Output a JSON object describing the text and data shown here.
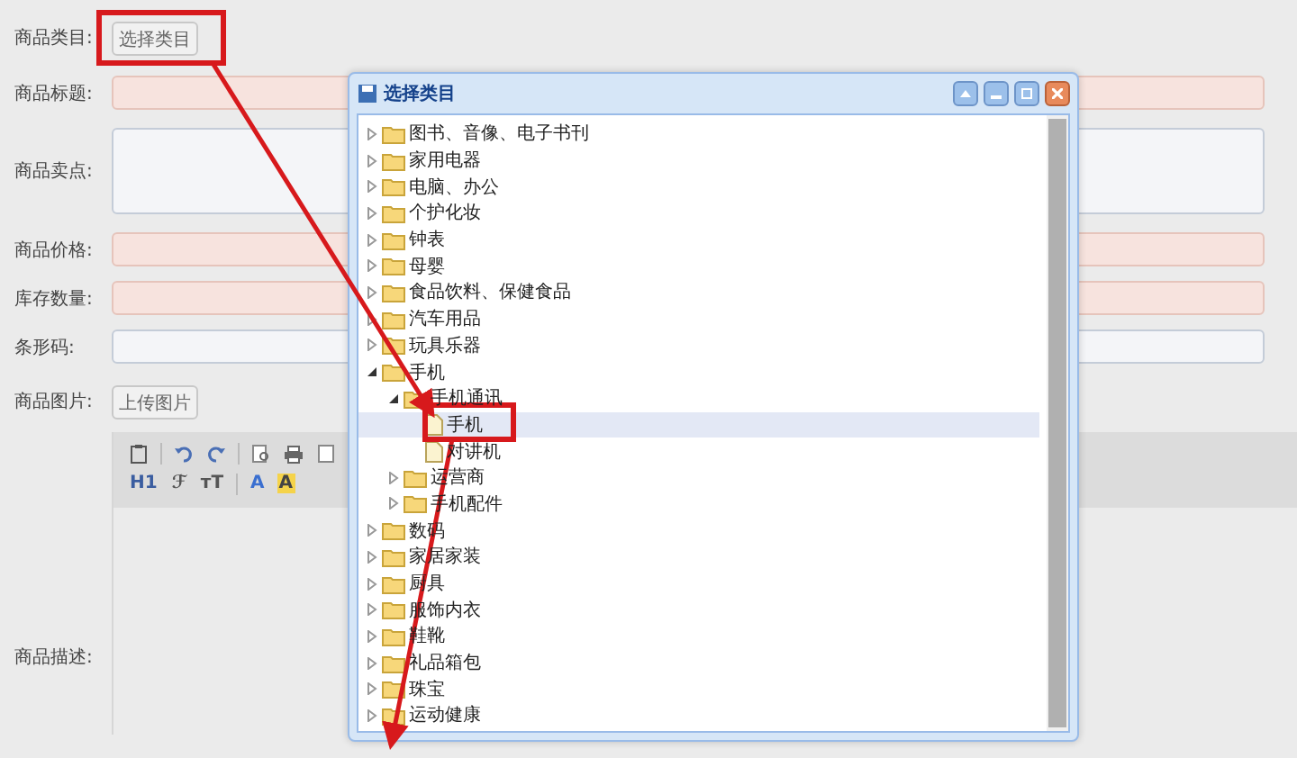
{
  "form": {
    "fields": [
      {
        "label": "商品类目:",
        "kind": "button",
        "button_label": "选择类目"
      },
      {
        "label": "商品标题:",
        "kind": "input",
        "required": true
      },
      {
        "label": "商品卖点:",
        "kind": "textarea",
        "required": false
      },
      {
        "label": "商品价格:",
        "kind": "input",
        "required": true
      },
      {
        "label": "库存数量:",
        "kind": "input",
        "required": true
      },
      {
        "label": "条形码:",
        "kind": "input",
        "required": false
      },
      {
        "label": "商品图片:",
        "kind": "button",
        "button_label": "上传图片"
      }
    ],
    "editor": {
      "label": "商品描述:",
      "toolbar_rows": [
        [
          {
            "kind": "paste"
          },
          {
            "kind": "separator"
          },
          {
            "kind": "undo"
          },
          {
            "kind": "redo"
          },
          {
            "kind": "separator"
          },
          {
            "kind": "preview"
          },
          {
            "kind": "print"
          },
          {
            "kind": "document"
          }
        ],
        [
          {
            "kind": "heading",
            "label": "H1"
          },
          {
            "kind": "font",
            "label": "ℱ"
          },
          {
            "kind": "size",
            "label": "тT"
          },
          {
            "kind": "separator"
          },
          {
            "kind": "color",
            "label": "A"
          },
          {
            "kind": "highlight",
            "label": "A"
          }
        ]
      ]
    }
  },
  "dialog": {
    "title": "选择类目",
    "tree": [
      {
        "label": "图书、音像、电子书刊",
        "kind": "folder",
        "expanded": false,
        "selected": false
      },
      {
        "label": "家用电器",
        "kind": "folder",
        "expanded": false,
        "selected": false
      },
      {
        "label": "电脑、办公",
        "kind": "folder",
        "expanded": false,
        "selected": false
      },
      {
        "label": "个护化妆",
        "kind": "folder",
        "expanded": false,
        "selected": false
      },
      {
        "label": "钟表",
        "kind": "folder",
        "expanded": false,
        "selected": false
      },
      {
        "label": "母婴",
        "kind": "folder",
        "expanded": false,
        "selected": false
      },
      {
        "label": "食品饮料、保健食品",
        "kind": "folder",
        "expanded": false,
        "selected": false
      },
      {
        "label": "汽车用品",
        "kind": "folder",
        "expanded": false,
        "selected": false
      },
      {
        "label": "玩具乐器",
        "kind": "folder",
        "expanded": false,
        "selected": false
      },
      {
        "label": "手机",
        "kind": "folder",
        "expanded": true,
        "selected": false,
        "children": [
          {
            "label": "手机通讯",
            "kind": "folder",
            "expanded": true,
            "selected": false,
            "children": [
              {
                "label": "手机",
                "kind": "file",
                "selected": true
              },
              {
                "label": "对讲机",
                "kind": "file",
                "selected": false
              }
            ]
          },
          {
            "label": "运营商",
            "kind": "folder",
            "expanded": false,
            "selected": false
          },
          {
            "label": "手机配件",
            "kind": "folder",
            "expanded": false,
            "selected": false
          }
        ]
      },
      {
        "label": "数码",
        "kind": "folder",
        "expanded": false,
        "selected": false
      },
      {
        "label": "家居家装",
        "kind": "folder",
        "expanded": false,
        "selected": false
      },
      {
        "label": "厨具",
        "kind": "folder",
        "expanded": false,
        "selected": false
      },
      {
        "label": "服饰内衣",
        "kind": "folder",
        "expanded": false,
        "selected": false
      },
      {
        "label": "鞋靴",
        "kind": "folder",
        "expanded": false,
        "selected": false
      },
      {
        "label": "礼品箱包",
        "kind": "folder",
        "expanded": false,
        "selected": false
      },
      {
        "label": "珠宝",
        "kind": "folder",
        "expanded": false,
        "selected": false
      },
      {
        "label": "运动健康",
        "kind": "folder",
        "expanded": false,
        "selected": false
      }
    ]
  }
}
